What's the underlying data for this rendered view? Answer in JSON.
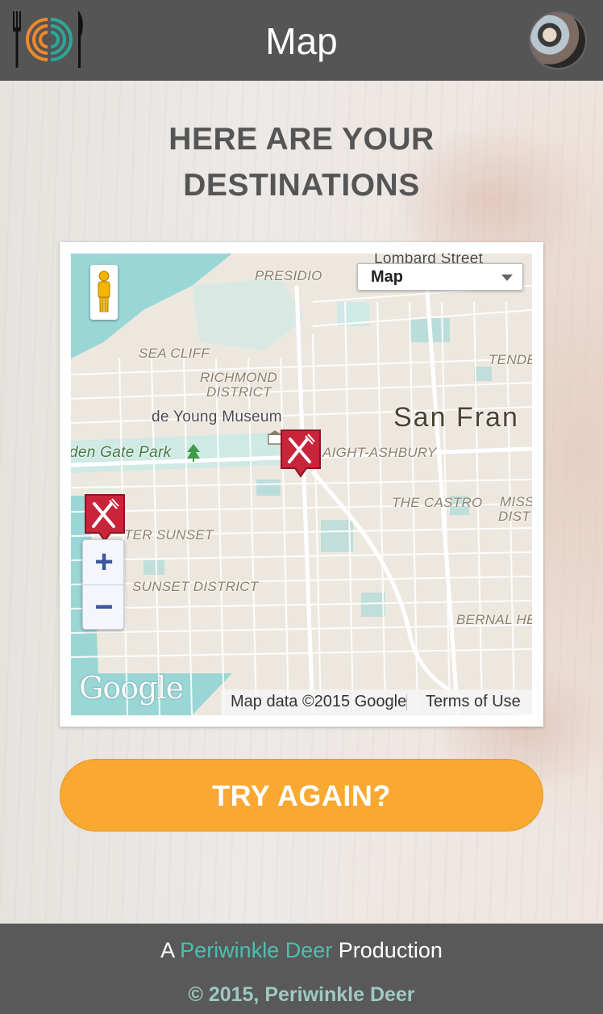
{
  "header": {
    "title": "Map"
  },
  "main": {
    "headline_line1": "HERE ARE YOUR",
    "headline_line2": "DESTINATIONS"
  },
  "map": {
    "map_type_label": "Map",
    "street_label": "Lombard Street",
    "labels": {
      "presidio": "PRESIDIO",
      "sea_cliff": "SEA CLIFF",
      "richmond_1": "RICHMOND",
      "richmond_2": "DISTRICT",
      "tenderloin": "TENDE",
      "de_young": "de Young Museum",
      "city": "San Fran",
      "park": "den Gate Park",
      "haight": "AIGHT-ASHBURY",
      "castro": "THE CASTRO",
      "mission_1": "MISS",
      "mission_2": "DIST",
      "outer_sunset": "TER SUNSET",
      "sunset": "SUNSET DISTRICT",
      "bernal": "BERNAL HE"
    },
    "zoom_in": "+",
    "zoom_out": "−",
    "google": "Google",
    "attribution_data": "Map data ©2015 Google",
    "attribution_terms": "Terms of Use",
    "colors": {
      "water": "#9ad6d6",
      "land": "#ede8df",
      "road": "#ffffff",
      "pin": "#c8243a"
    }
  },
  "actions": {
    "try_again_label": "TRY AGAIN?"
  },
  "footer": {
    "prefix": "A",
    "brand": "Periwinkle Deer",
    "suffix": "Production",
    "copyright": "© 2015, Periwinkle Deer"
  },
  "theme": {
    "header_bg": "#555555",
    "accent_orange": "#f9a832",
    "accent_teal": "#4bbfb1"
  },
  "icons": [
    "fork-icon",
    "knife-icon",
    "logo-icon",
    "pegman-icon",
    "restaurant-pin-icon",
    "museum-icon",
    "tree-icon",
    "dropdown-arrow-icon"
  ]
}
